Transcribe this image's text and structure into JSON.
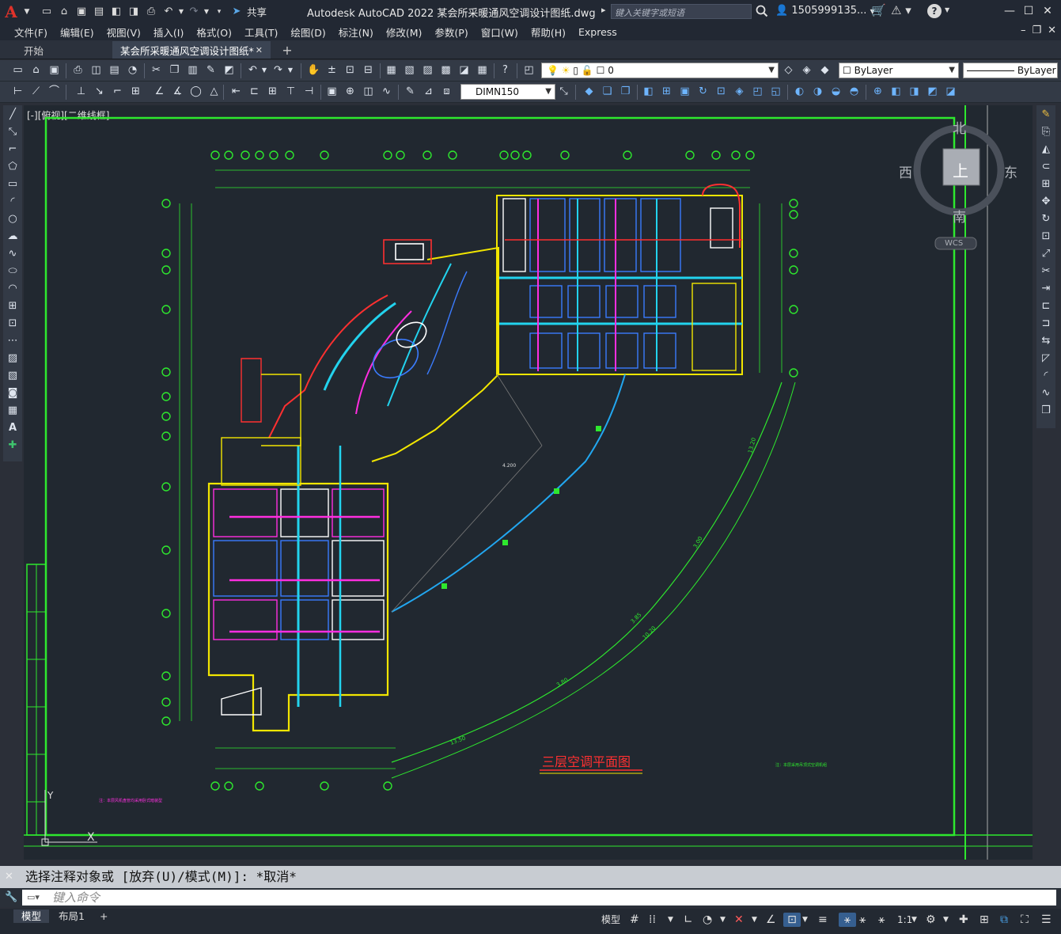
{
  "app": {
    "logo_letter": "A",
    "title": "Autodesk AutoCAD 2022    某会所采暖通风空调设计图纸.dwg",
    "share_label": "共享",
    "search_placeholder": "键入关键字或短语",
    "user": "1505999135...",
    "accent_color": "#e0322a"
  },
  "menu": [
    "文件(F)",
    "编辑(E)",
    "视图(V)",
    "插入(I)",
    "格式(O)",
    "工具(T)",
    "绘图(D)",
    "标注(N)",
    "修改(M)",
    "参数(P)",
    "窗口(W)",
    "帮助(H)",
    "Express"
  ],
  "tabs": [
    {
      "label": "开始",
      "active": false
    },
    {
      "label": "某会所采暖通风空调设计图纸*",
      "active": true
    }
  ],
  "toolbar": {
    "layer_value": "0",
    "color_value": "ByLayer",
    "linetype_value": "ByLayer",
    "dimstyle_value": "DIMN150"
  },
  "drawing": {
    "viewport_label": "[-][俯视][二维线框]",
    "plan_title": "三层空调平面图",
    "axis_x_label": "X",
    "axis_y_label": "Y",
    "dim_labels": [
      "4.200",
      "13.20",
      "3.00",
      "3.85",
      "10.20",
      "3.80",
      "13.50"
    ],
    "note_text": "注：本层采用吊顶式空调机组",
    "note_left": "注：本层风机盘管均采用卧式暗装型"
  },
  "viewcube": {
    "north": "北",
    "south": "南",
    "east": "东",
    "west": "西",
    "top": "上",
    "wcs": "WCS"
  },
  "command": {
    "history": "选择注释对象或 [放弃(U)/模式(M)]: *取消*",
    "placeholder": "键入命令"
  },
  "status": {
    "layouts": [
      "模型",
      "布局1"
    ],
    "model_label": "模型",
    "scale": "1:1"
  }
}
